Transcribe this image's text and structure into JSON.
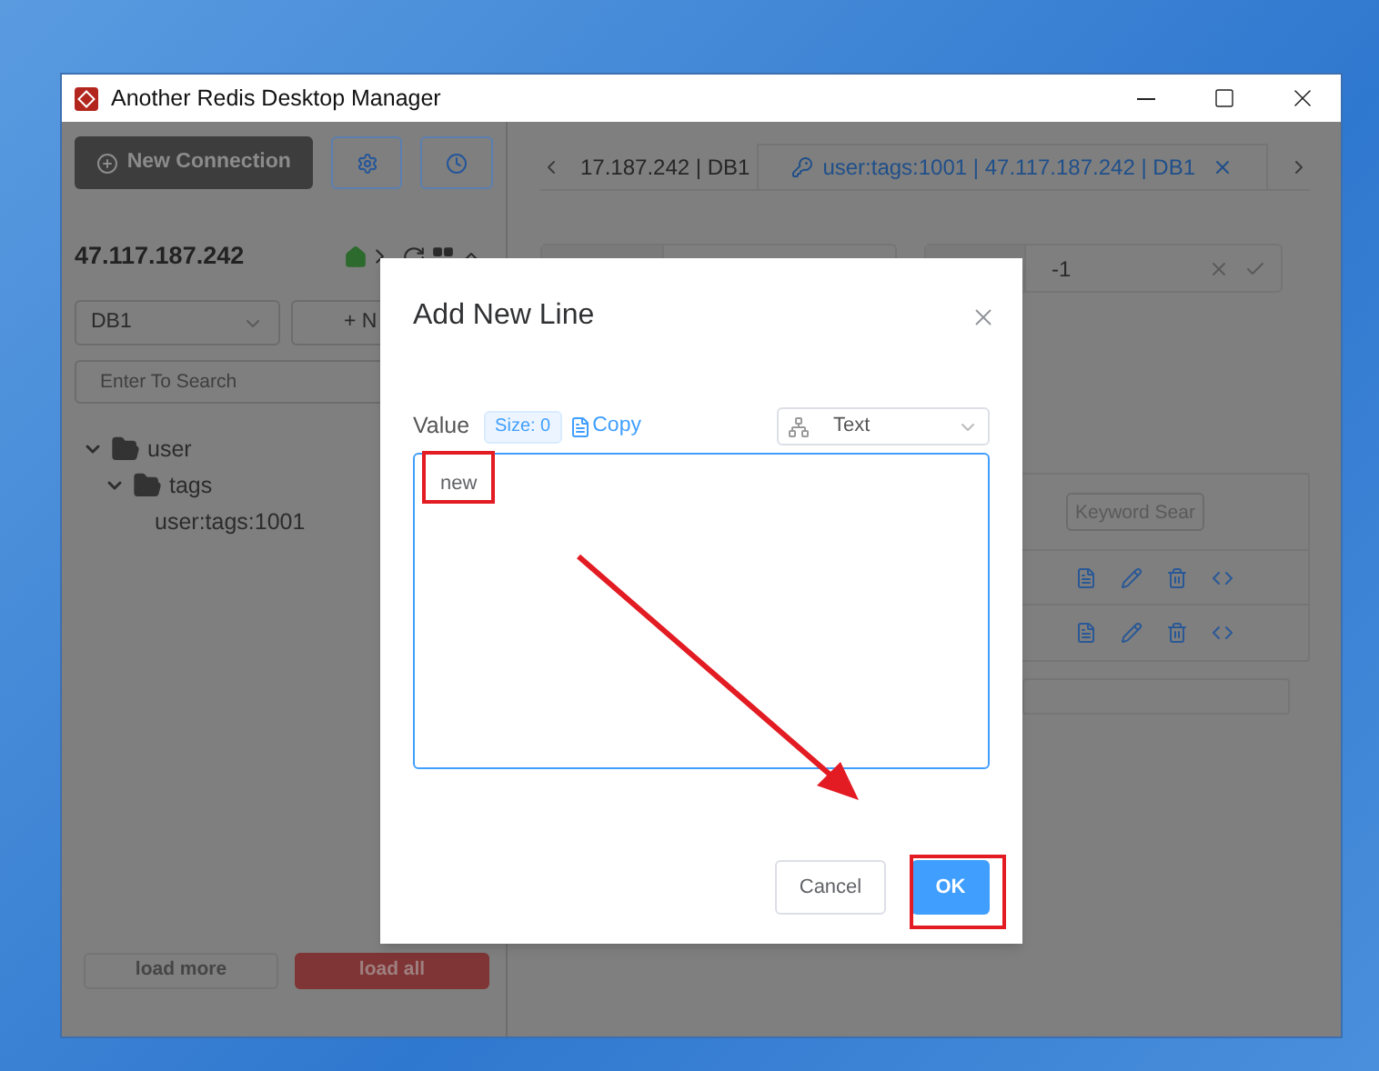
{
  "window": {
    "title": "Another Redis Desktop Manager"
  },
  "sidebar": {
    "new_connection": "New Connection",
    "server": "47.117.187.242",
    "db_select": "DB1",
    "new_key_button": "+ N",
    "search": {
      "placeholder": "Enter To Search"
    },
    "tree": [
      {
        "label": "user",
        "expanded": true,
        "children": [
          {
            "label": "tags",
            "expanded": true,
            "children": [
              {
                "label": "user:tags:1001"
              }
            ]
          }
        ]
      }
    ],
    "load_more": "load more",
    "load_all": "load all"
  },
  "tabs": [
    {
      "label": "17.187.242 | DB1",
      "selected": false
    },
    {
      "label": "user:tags:1001 | 47.117.187.242 | DB1",
      "selected": true
    }
  ],
  "ttl": {
    "value": "-1"
  },
  "table": {
    "search": {
      "placeholder": "Keyword Sear"
    }
  },
  "dialog": {
    "title": "Add New Line",
    "value_label": "Value",
    "size_badge": "Size: 0",
    "copy_link": "Copy",
    "format_select": "Text",
    "value": "new",
    "buttons": [
      {
        "label": "Cancel",
        "kind": "secondary"
      },
      {
        "label": "OK",
        "kind": "primary"
      }
    ]
  }
}
